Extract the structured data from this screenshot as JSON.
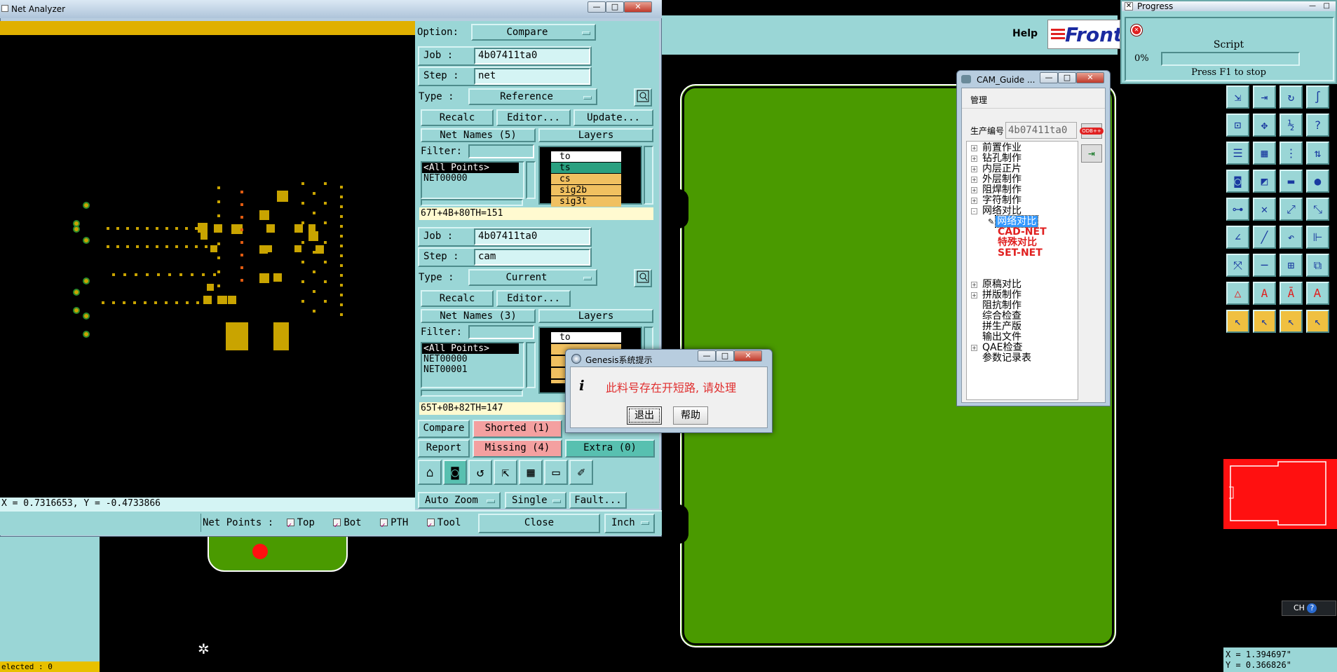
{
  "net_analyzer": {
    "title": "Net Analyzer",
    "coords": "X = 0.7316653, Y = -0.4733866",
    "option_label": "Option:",
    "option_value": "Compare",
    "job_label": "Job  :",
    "step_label": "Step :",
    "type_label": "Type :",
    "ref": {
      "job": "4b07411ta0",
      "step": "net",
      "type": "Reference",
      "recalc": "Recalc",
      "editor": "Editor...",
      "update": "Update...",
      "netnames_header": "Net Names (5)",
      "layers_header": "Layers",
      "filter_label": "Filter:",
      "nets": [
        "<All Points>",
        "NET00000"
      ],
      "layers": [
        "to",
        "ts",
        "cs",
        "sig2b",
        "sig3t"
      ],
      "summary": "67T+4B+80TH=151"
    },
    "cur": {
      "job": "4b07411ta0",
      "step": "cam",
      "type": "Current",
      "recalc": "Recalc",
      "editor": "Editor...",
      "netnames_header": "Net Names (3)",
      "layers_header": "Layers",
      "filter_label": "Filter:",
      "nets": [
        "<All Points>",
        "NET00000",
        "NET00001"
      ],
      "layers": [
        "to"
      ],
      "summary": "65T+0B+82TH=147"
    },
    "compare_btn": "Compare",
    "report_btn": "Report",
    "shorted": "Shorted (1)",
    "missing": "Missing (4)",
    "extra": "Extra (0)",
    "auto_zoom": "Auto Zoom",
    "single": "Single",
    "fault": "Fault...",
    "net_points_label": "Net Points :",
    "np_top": "Top",
    "np_bot": "Bot",
    "np_pth": "PTH",
    "np_tool": "Tool",
    "close": "Close",
    "units": "Inch"
  },
  "main_window": {
    "help": "Help",
    "logo": "Front",
    "selected": "elected : 0",
    "coords_x": "X = 1.394697\"",
    "coords_y": "Y = 0.366826\""
  },
  "progress": {
    "title": "Progress",
    "script": "Script",
    "percent": "0%",
    "hint": "Press F1 to stop",
    "value": 0
  },
  "cam_guide": {
    "title": "CAM_Guide ...",
    "menu": "管理",
    "prod_label": "生产编号",
    "prod_value": "4b07411ta0",
    "odb_badge": "ODB++",
    "tree": [
      {
        "label": "前置作业",
        "expander": "+"
      },
      {
        "label": "钻孔制作",
        "expander": "+"
      },
      {
        "label": "内层正片",
        "expander": "+"
      },
      {
        "label": "外层制作",
        "expander": "+"
      },
      {
        "label": "阻焊制作",
        "expander": "+"
      },
      {
        "label": "字符制作",
        "expander": "+"
      },
      {
        "label": "网络对比",
        "expander": "-"
      }
    ],
    "sub": [
      "网络对比",
      "CAD-NET",
      "特殊对比",
      "SET-NET"
    ],
    "tree2": [
      {
        "label": "原稿对比",
        "expander": "+"
      },
      {
        "label": "拼版制作",
        "expander": "+"
      },
      {
        "label": "阻抗制作",
        "expander": ""
      },
      {
        "label": "综合检查",
        "expander": ""
      },
      {
        "label": "拼生产版",
        "expander": ""
      },
      {
        "label": "输出文件",
        "expander": ""
      },
      {
        "label": "QAE检查",
        "expander": "+"
      },
      {
        "label": "参数记录表",
        "expander": ""
      }
    ]
  },
  "dialog": {
    "title": "Genesis系统提示",
    "message": "此料号存在开短路, 请处理",
    "exit": "退出",
    "help": "帮助"
  },
  "ime": {
    "label": "CH"
  },
  "colors": {
    "teal": "#9ad6d6",
    "board_green": "#4a9a00",
    "yellow_bar": "#e0b000",
    "red_error": "#e03030"
  }
}
